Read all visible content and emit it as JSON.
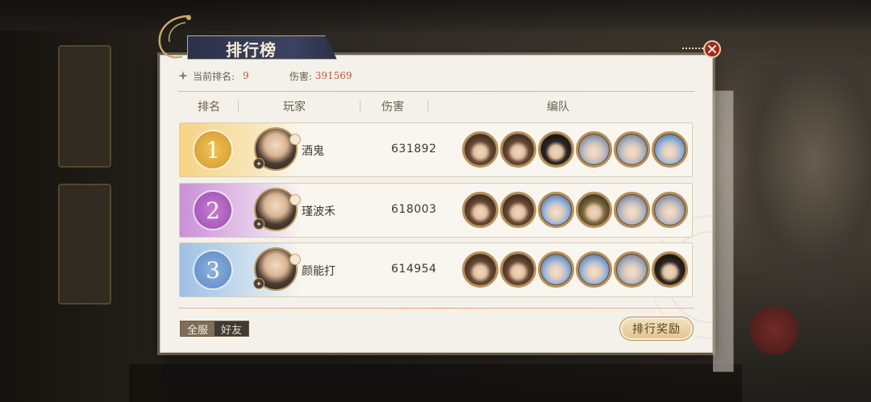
{
  "panel": {
    "title": "排行榜",
    "current_rank_label": "当前排名:",
    "current_rank_value": "9",
    "damage_label": "伤害:",
    "damage_value": "391569"
  },
  "table": {
    "columns": [
      "排名",
      "玩家",
      "伤害",
      "编队"
    ],
    "rows": [
      {
        "rank": "1",
        "name": "酒鬼",
        "damage": "631892",
        "team": [
          "hair-brown",
          "hair-brown",
          "hair-dark",
          "hair-silver",
          "hair-silver",
          "hair-blue"
        ]
      },
      {
        "rank": "2",
        "name": "瑾波禾",
        "damage": "618003",
        "team": [
          "hair-brown",
          "hair-brown",
          "hair-blue",
          "hair-olive",
          "hair-silver",
          "hair-silver"
        ]
      },
      {
        "rank": "3",
        "name": "颜能打",
        "damage": "614954",
        "team": [
          "hair-brown",
          "hair-brown",
          "hair-blue",
          "hair-blue",
          "hair-silver",
          "hair-dark"
        ]
      }
    ]
  },
  "tabs": {
    "all_server": "全服",
    "friends": "好友",
    "active": "all_server"
  },
  "buttons": {
    "reward": "排行奖励"
  },
  "colors": {
    "accent_red": "#b85a45",
    "banner_navy": "#2b3148",
    "gold": "#c9a96a"
  }
}
